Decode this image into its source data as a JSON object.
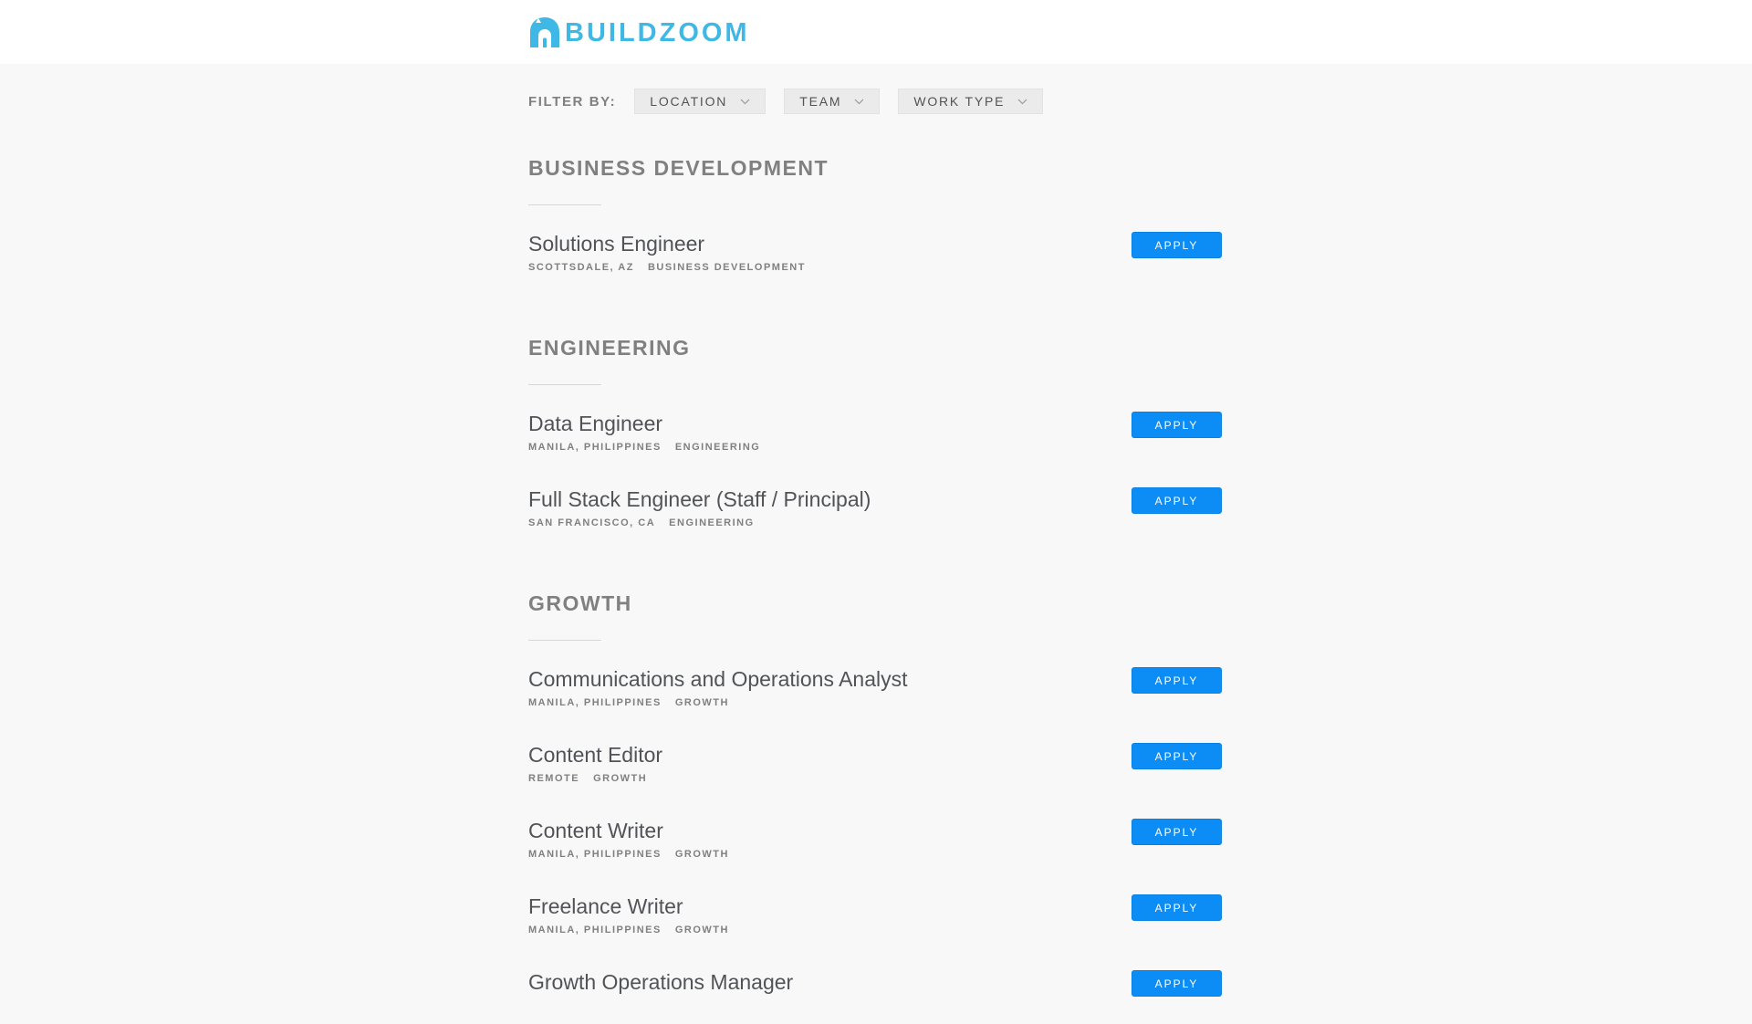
{
  "header": {
    "logo_text": "BUILDZOOM",
    "logo_icon": "house-logo-icon"
  },
  "colors": {
    "brand": "#3fb8e6",
    "apply_button": "#0c8cf5",
    "page_background": "#f8f8f8",
    "header_background": "#ffffff",
    "muted_text": "#808080",
    "title_text": "#515357"
  },
  "filters": {
    "label": "FILTER BY:",
    "location": "LOCATION",
    "team": "TEAM",
    "work_type": "WORK TYPE",
    "chevron_icon": "chevron-down-icon"
  },
  "apply_label": "APPLY",
  "sections": [
    {
      "title": "BUSINESS DEVELOPMENT",
      "postings": [
        {
          "title": "Solutions Engineer",
          "location": "SCOTTSDALE, AZ",
          "team": "BUSINESS DEVELOPMENT"
        }
      ]
    },
    {
      "title": "ENGINEERING",
      "postings": [
        {
          "title": "Data Engineer",
          "location": "MANILA, PHILIPPINES",
          "team": "ENGINEERING"
        },
        {
          "title": "Full Stack Engineer (Staff / Principal)",
          "location": "SAN FRANCISCO, CA",
          "team": "ENGINEERING"
        }
      ]
    },
    {
      "title": "GROWTH",
      "postings": [
        {
          "title": "Communications and Operations Analyst",
          "location": "MANILA, PHILIPPINES",
          "team": "GROWTH"
        },
        {
          "title": "Content Editor",
          "location": "REMOTE",
          "team": "GROWTH"
        },
        {
          "title": "Content Writer",
          "location": "MANILA, PHILIPPINES",
          "team": "GROWTH"
        },
        {
          "title": "Freelance Writer",
          "location": "MANILA, PHILIPPINES",
          "team": "GROWTH"
        },
        {
          "title": "Growth Operations Manager",
          "location": "",
          "team": ""
        }
      ]
    }
  ]
}
